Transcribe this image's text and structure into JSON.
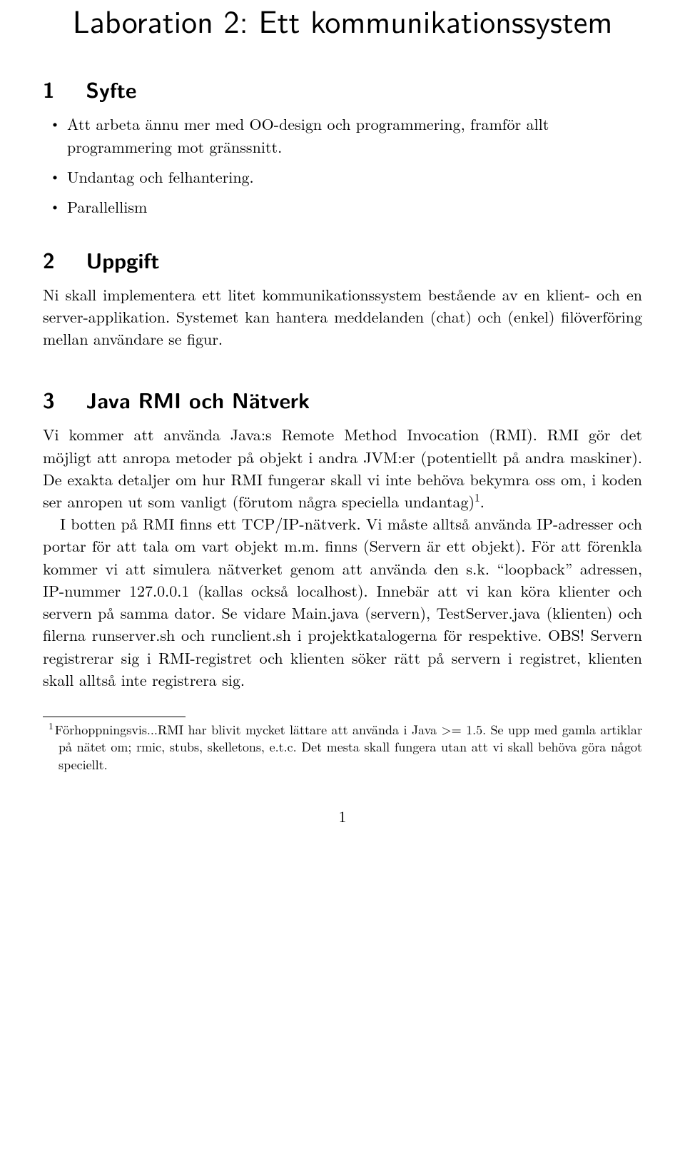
{
  "title": "Laboration 2: Ett kommunikationssystem",
  "sections": {
    "s1": {
      "number": "1",
      "heading": "Syfte",
      "bullets": [
        "Att arbeta ännu mer med OO-design och programmering, framför allt programmering mot gränssnitt.",
        "Undantag och felhantering.",
        "Parallellism"
      ]
    },
    "s2": {
      "number": "2",
      "heading": "Uppgift",
      "paragraph": "Ni skall implementera ett litet kommunikationssystem bestående av en klient- och en server-applikation. Systemet kan hantera meddelanden (chat) och (enkel) filöverföring mellan användare se figur."
    },
    "s3": {
      "number": "3",
      "heading": "Java RMI och Nätverk",
      "p1_before_sup": "Vi kommer att använda Java:s Remote Method Invocation (RMI). RMI gör det möjligt att anropa metoder på objekt i andra JVM:er (potentiellt på andra maskiner). De exakta detaljer om hur RMI fungerar skall vi inte behöva bekymra oss om, i koden ser anropen ut som vanligt (förutom några speciella undantag)",
      "p1_sup": "1",
      "p1_after_sup": ".",
      "p2": "I botten på RMI finns ett TCP/IP-nätverk. Vi måste alltså använda IP-adresser och portar för att tala om vart objekt m.m. finns (Servern är ett objekt). För att förenkla kommer vi att simulera nätverket genom att använda den s.k. “loopback” adressen, IP-nummer 127.0.0.1 (kallas också localhost). Innebär att vi kan köra klienter och servern på samma dator. Se vidare Main.java (servern), TestServer.java (klienten) och filerna runserver.sh och runclient.sh i projektkatalogerna för respektive. OBS! Servern registrerar sig i RMI-registret och klienten söker rätt på servern i registret, klienten skall alltså inte registrera sig."
    }
  },
  "footnote": {
    "marker": "1",
    "text": "Förhoppningsvis...RMI har blivit mycket lättare att använda i Java >= 1.5. Se upp med gamla artiklar på nätet om; rmic, stubs, skelletons, e.t.c. Det mesta skall fungera utan att vi skall behöva göra något speciellt."
  },
  "page_number": "1"
}
